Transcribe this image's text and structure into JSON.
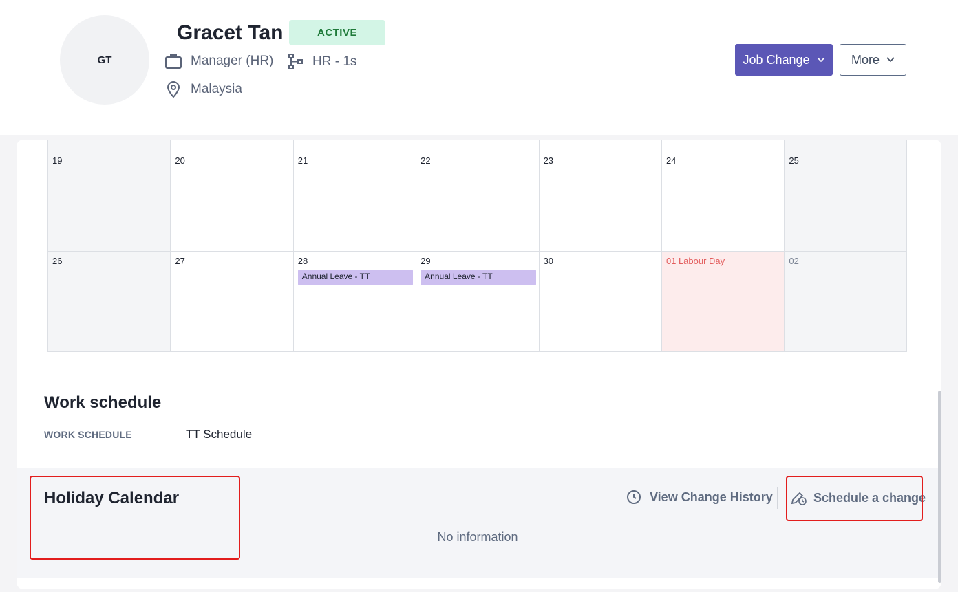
{
  "profile": {
    "initials": "GT",
    "name": "Gracet Tan",
    "status": "ACTIVE",
    "job_title": "Manager (HR)",
    "department": "HR - 1s",
    "location": "Malaysia"
  },
  "actions": {
    "job_change_label": "Job Change",
    "more_label": "More"
  },
  "calendar": {
    "weeks": [
      {
        "days": [
          {
            "day": "19",
            "weekend": true
          },
          {
            "day": "20"
          },
          {
            "day": "21"
          },
          {
            "day": "22"
          },
          {
            "day": "23"
          },
          {
            "day": "24"
          },
          {
            "day": "25",
            "weekend": true
          }
        ]
      },
      {
        "days": [
          {
            "day": "26",
            "weekend": true
          },
          {
            "day": "27"
          },
          {
            "day": "28",
            "event": "Annual Leave - TT"
          },
          {
            "day": "29",
            "event": "Annual Leave - TT"
          },
          {
            "day": "30"
          },
          {
            "day": "01",
            "holiday": "Labour Day"
          },
          {
            "day": "02",
            "weekend": true,
            "muted": true
          }
        ]
      }
    ]
  },
  "work_schedule": {
    "title": "Work schedule",
    "label": "WORK SCHEDULE",
    "value": "TT Schedule"
  },
  "holiday_calendar": {
    "title": "Holiday Calendar",
    "view_history_label": "View Change History",
    "schedule_change_label": "Schedule a change",
    "empty_text": "No information"
  },
  "colors": {
    "primary": "#5b57b6",
    "status_bg": "#d3f5e6",
    "event_bg": "#cdbff0",
    "holiday_bg": "#fdecec",
    "holiday_text": "#e35d5d",
    "highlight": "#e21d1d"
  }
}
